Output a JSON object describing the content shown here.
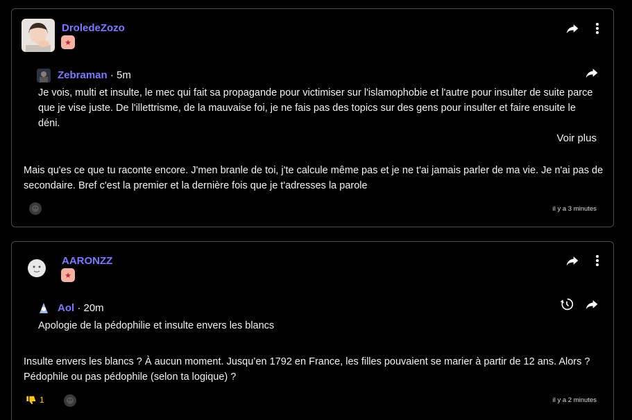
{
  "posts": [
    {
      "author": "DroledeZozo",
      "badge_icon": "star-badge-icon",
      "quote": {
        "author": "Zebraman",
        "time": " · 5m",
        "text": "Je vois, multi et insulte, le mec qui fait sa propagande pour victimiser sur l'islamophobie et l'autre pour insulter de suite parce que je vise juste. De l'illettrisme, de la mauvaise foi, je ne fais pas des topics sur des gens pour insulter et faire ensuite le déni.",
        "more_label": "Voir plus"
      },
      "text": "Mais qu'es ce que tu raconte encore. J'men branle de toi, j'te calcule même pas et je ne t'ai jamais parler de ma vie. Je n'ai pas de secondaire. Bref c'est la premier et la dernière fois que je t'adresses la parole",
      "timestamp": "il y a 3 minutes"
    },
    {
      "author": "AARONZZ",
      "badge_icon": "star-badge-icon",
      "quote": {
        "author": "Aol",
        "time": " · 20m",
        "text": "Apologie de la pédophilie et insulte envers les blancs"
      },
      "text": "Insulte envers les blancs ? À aucun moment. Jusqu’en 1792 en France, les filles pouvaient se marier à partir de 12 ans. Alors ? Pédophile ou pas pédophile (selon ta logique) ?",
      "dislike_count": "1",
      "timestamp": "il y a 2 minutes"
    }
  ],
  "colors": {
    "accent": "#7b78ff",
    "badge": "#f7b0a6",
    "dislike": "#f5c518",
    "border": "#4a4a4a"
  }
}
